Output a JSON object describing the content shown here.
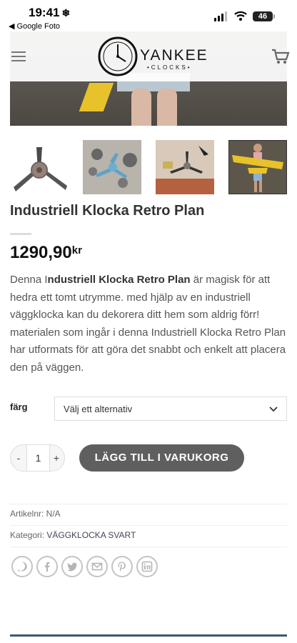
{
  "status_bar": {
    "time": "19:41",
    "back_app": "◀ Google Foto",
    "battery": "46"
  },
  "header": {
    "logo_name": "YANKEE",
    "logo_sub": "•CLOCKS•"
  },
  "product": {
    "title": "Industriell Klocka Retro Plan",
    "price": "1290,90",
    "currency": "kr",
    "description_prefix": "Denna I",
    "description_bold": "ndustriell Klocka Retro Plan",
    "description_rest": " är magisk för att hedra ett tomt utrymme. med hjälp av en industriell väggklocka kan du dekorera ditt hem som aldrig förr! materialen som ingår i denna Industriell Klocka Retro Plan har utformats för att göra det snabbt och enkelt att placera den på väggen."
  },
  "variation": {
    "label": "färg",
    "placeholder": "Välj ett alternativ"
  },
  "quantity": {
    "minus": "-",
    "value": "1",
    "plus": "+"
  },
  "add_to_cart": "LÄGG TILL I VARUKORG",
  "meta": {
    "sku_label": "Artikelnr: N/A",
    "category_label": "Kategori: ",
    "category_value": "VÄGGKLOCKA SVART"
  },
  "share_icons": [
    "whatsapp-icon",
    "facebook-icon",
    "twitter-icon",
    "email-icon",
    "pinterest-icon",
    "linkedin-icon"
  ],
  "colors": {
    "button": "#5f5f5f",
    "footer_line": "#3f5670",
    "plane_yellow": "#e8c22a"
  }
}
